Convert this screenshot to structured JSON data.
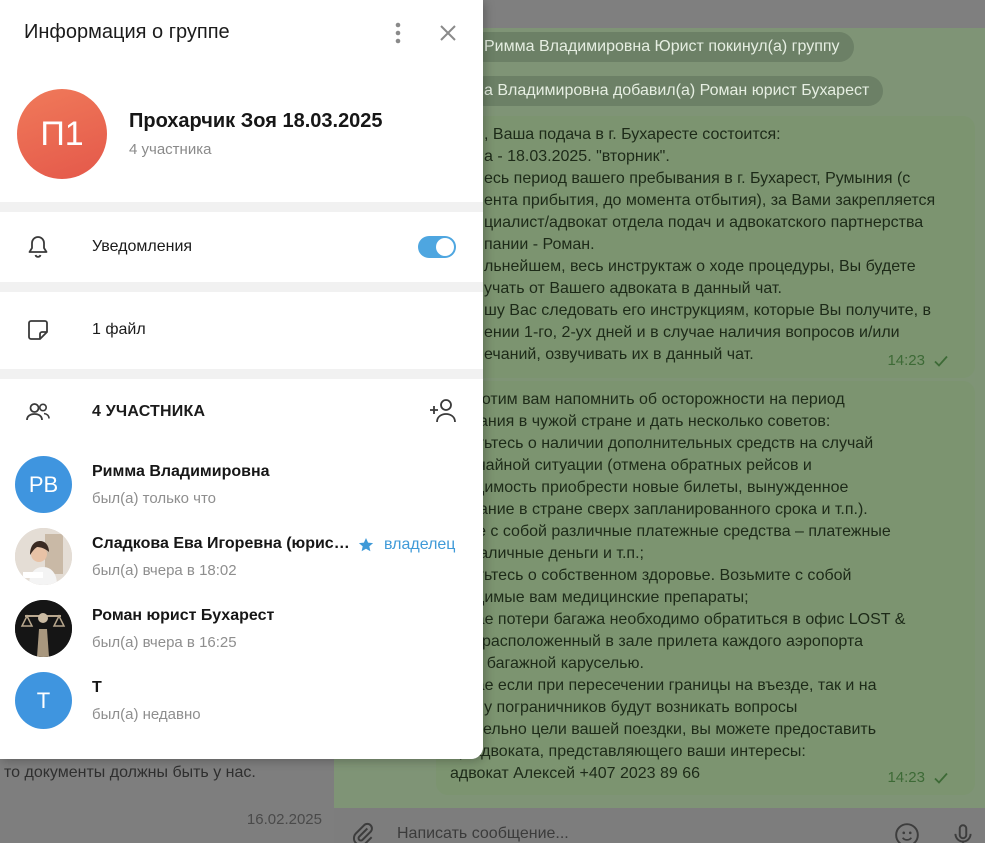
{
  "panel": {
    "title": "Информация о группе",
    "group": {
      "avatar_initials": "П1",
      "name": "Прохарчик Зоя 18.03.2025",
      "member_count": "4 участника"
    },
    "notifications": {
      "label": "Уведомления",
      "enabled": true
    },
    "files": {
      "label": "1 файл"
    },
    "members": {
      "heading": "4 УЧАСТНИКА",
      "items": [
        {
          "name": "Римма Владимировна",
          "status": "был(а) только что",
          "initials": "РВ"
        },
        {
          "name": "Сладкова Ева Игоревна (юрис…",
          "status": "был(а) вчера в 18:02",
          "role": "владелец"
        },
        {
          "name": "Роман юрист Бухарест",
          "status": "был(а) вчера в 16:25"
        },
        {
          "name": "Т",
          "status": "был(а) недавно",
          "initials": "Т"
        }
      ]
    }
  },
  "background": {
    "left_preview": {
      "text": "то документы должны быть у нас.",
      "date": "16.02.2025"
    },
    "service_messages": [
      "Римма Владимировна Юрист покинул(а) группу",
      "а Владимировна добавил(а) Роман юрист Бухарест"
    ],
    "messages": [
      {
        "lines": [
          ", Ваша подача в г. Бухаресте состоится:",
          "а - 18.03.2025. \"вторник\".",
          "есь период вашего пребывания в г. Бухарест, Румыния (с",
          "ента прибытия, до момента отбытия), за Вами закрепляется",
          "циалист/адвокат отдела подач и адвокатского партнерства",
          "пании - Роман.",
          "льнейшем, весь инструктаж о ходе процедуры, Вы будете",
          "учать от Вашего адвоката в данный чат.",
          "шу Вас следовать его инструкциям, которые Вы получите, в",
          "ении 1-го, 2-ух дней и в случае наличия вопросов и/или",
          "ечаний, озвучивать их в данный чат."
        ],
        "time": "14:23"
      },
      {
        "lines": [
          "же хотим вам напомнить об осторожности на период",
          "бывания в чужой стране и дать несколько советов:",
          "аботьтесь о наличии дополнительных средств на случай",
          "звычайной ситуации (отмена обратных рейсов и",
          "бходимость приобрести новые билеты, вынужденное",
          "бывание в стране сверх запланированного срока и т.п.).",
          "мите с собой различные платежные средства – платежные",
          "ы, наличные деньги и т.п.;",
          "аботьтесь о собственном здоровье. Возьмите с собой",
          "бходимые вам медицинские препараты;",
          "лучае потери багажа необходимо обратиться в офис LOST &",
          "ND, расположенный в зале прилета каждого аэропорта",
          "ом с багажной каруселью.",
          "лучае если при пересечении границы на въезде, так и на",
          "зде, у пограничников будут возникать вопросы",
          "осительно цели вашей поездки, вы можете предоставить",
          "ер адвоката, представляющего ваши интересы:",
          "адвокат Алексей +407 2023 89 66"
        ],
        "time": "14:23"
      }
    ],
    "composer_placeholder": "Написать сообщение..."
  },
  "colors": {
    "accent": "#4ea6e0",
    "group_avatar": "#e9624e",
    "member_avatar": "#3f95df"
  }
}
